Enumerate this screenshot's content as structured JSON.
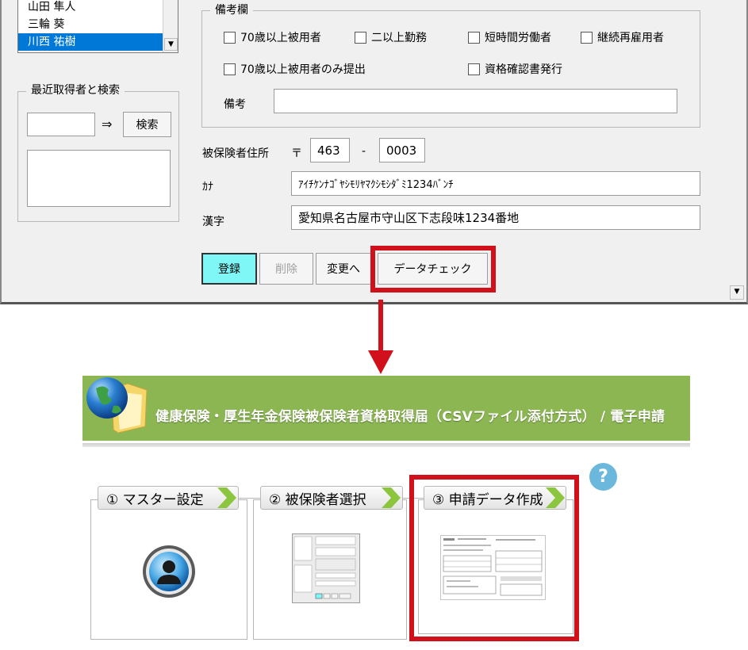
{
  "dialog": {
    "employee_list": [
      "山田 隼人",
      "三輪 葵",
      "川西 祐樹"
    ],
    "recent": {
      "group_label": "最近取得者と検索",
      "search_input": "",
      "arrow_glyph": "⇒",
      "search_button": "検索"
    },
    "remarks": {
      "group_label": "備考欄",
      "checkboxes": [
        "70歳以上被用者",
        "二以上勤務",
        "短時間労働者",
        "継続再雇用者",
        "70歳以上被用者のみ提出",
        "資格確認書発行"
      ],
      "note_label": "備考",
      "note_value": ""
    },
    "address": {
      "label": "被保険者住所",
      "postal_mark": "〒",
      "postal1": "463",
      "dash": "-",
      "postal2": "0003",
      "kana_label": "ｶﾅ",
      "kana_value": "ｱｲﾁｹﾝﾅｺﾞﾔｼﾓﾘﾔﾏｸｼﾓｼﾀﾞﾐ1234ﾊﾞﾝﾁ",
      "kanji_label": "漢字",
      "kanji_value": "愛知県名古屋市守山区下志段味1234番地"
    },
    "buttons": {
      "register": "登録",
      "delete": "削除",
      "change": "変更へ",
      "data_check": "データチェック"
    },
    "colors": {
      "highlight_red": "#d0101a",
      "selection_blue": "#0078d7",
      "register_cyan": "#7ff7f7"
    }
  },
  "panel": {
    "banner_title": "健康保険・厚生年金保険被保険者資格取得届（CSVファイル添付方式） / 電子申請",
    "help_glyph": "?",
    "steps": [
      {
        "label": "① マスター設定"
      },
      {
        "label": "② 被保険者選択"
      },
      {
        "label": "③ 申請データ作成"
      }
    ],
    "colors": {
      "banner_green": "#8bb652",
      "chevron_green": "#8cc63f",
      "help_blue": "#6cb8dc"
    }
  }
}
